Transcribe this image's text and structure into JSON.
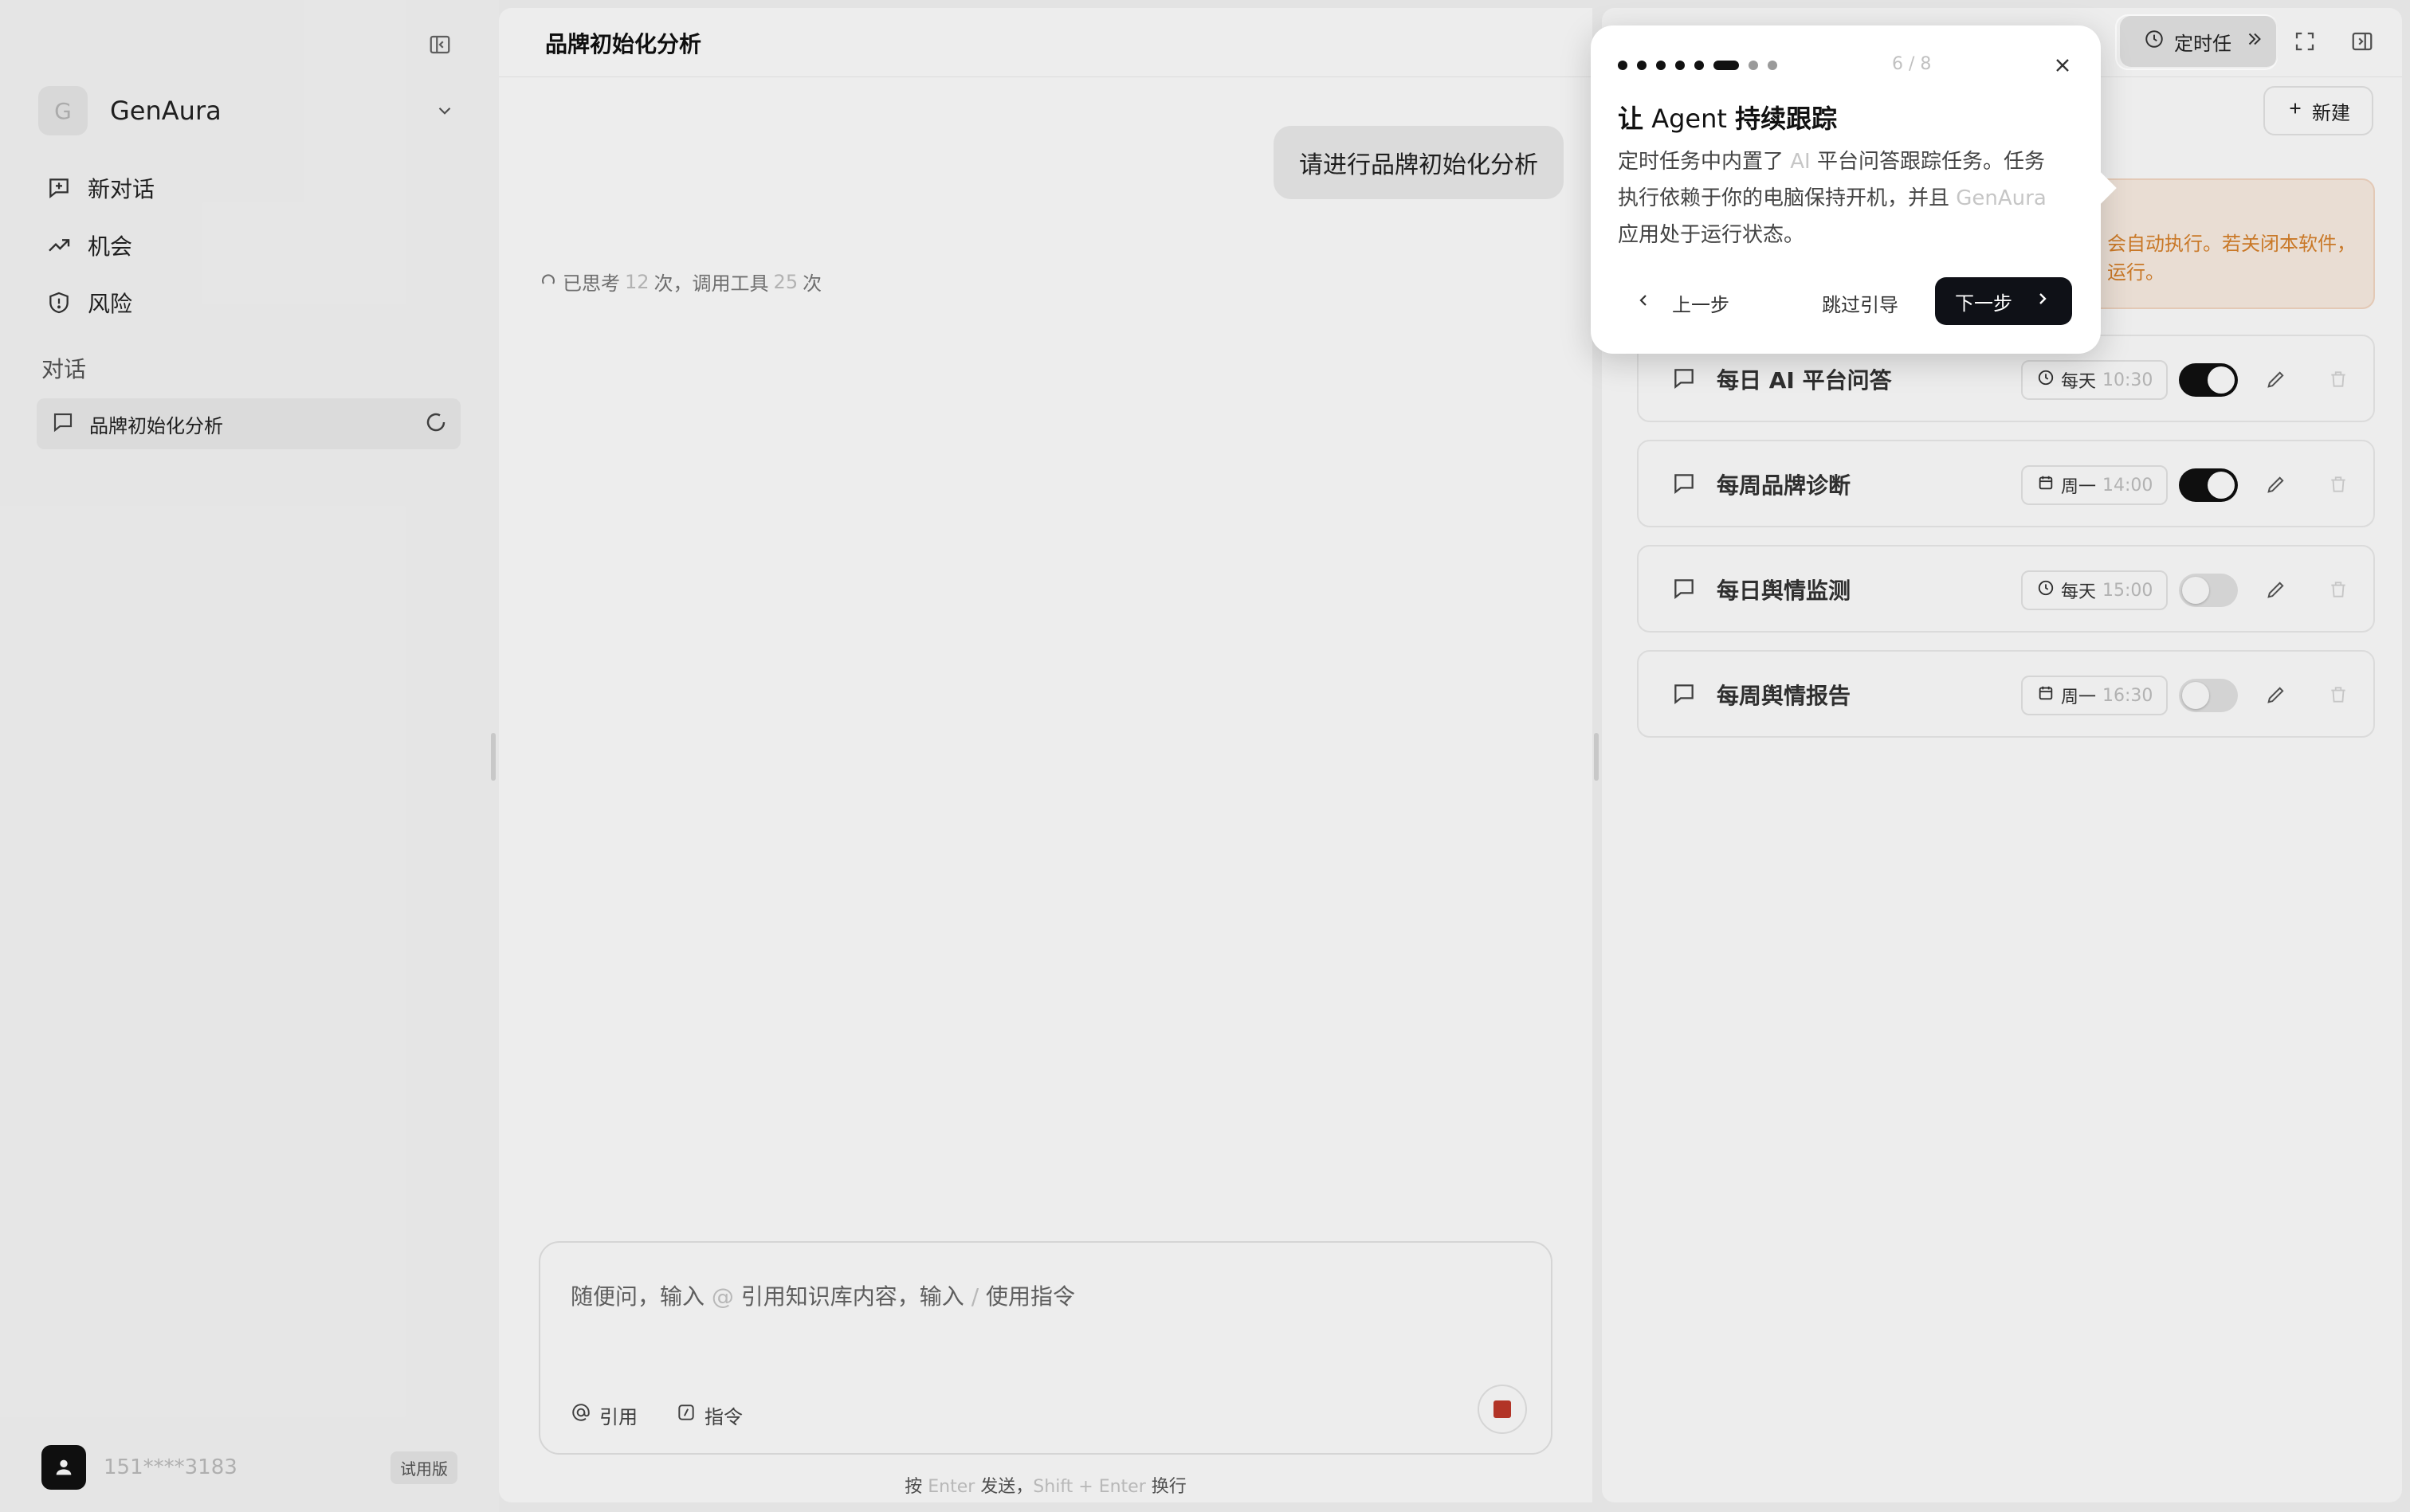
{
  "sidebar": {
    "workspace": {
      "initial": "G",
      "name": "GenAura"
    },
    "nav": [
      {
        "label": "新对话",
        "icon": "new-chat-icon"
      },
      {
        "label": "机会",
        "icon": "trending-up-icon"
      },
      {
        "label": "风险",
        "icon": "shield-alert-icon"
      }
    ],
    "section_label": "对话",
    "conversations": [
      {
        "label": "品牌初始化分析",
        "status": "loading"
      }
    ],
    "user": {
      "phone": "151****3183",
      "plan": "试用版"
    }
  },
  "main": {
    "title": "品牌初始化分析",
    "user_message": "请进行品牌初始化分析",
    "thinking": {
      "prefix": "已思考",
      "think_count": "12",
      "middle": "次，调用工具",
      "tool_count": "25",
      "suffix": "次"
    },
    "input": {
      "placeholder_parts": [
        "随便问，输入 ",
        "@",
        " 引用知识库内容，输入 ",
        "/",
        " 使用指令"
      ],
      "cite_label": "引用",
      "command_label": "指令"
    },
    "hint_parts": [
      "按 ",
      "Enter",
      " 发送，",
      "Shift + Enter",
      " 换行"
    ]
  },
  "right_panel": {
    "tab_label": "定时任",
    "new_button": "新建",
    "notice_lines": [
      "会自动执行。若关闭本软件，",
      "运行。"
    ],
    "tasks": [
      {
        "name": "每日 AI 平台问答",
        "freq": "每天",
        "time": "10:30",
        "enabled": true,
        "sched_icon": "clock-icon"
      },
      {
        "name": "每周品牌诊断",
        "freq": "周一",
        "time": "14:00",
        "enabled": true,
        "sched_icon": "calendar-icon"
      },
      {
        "name": "每日舆情监测",
        "freq": "每天",
        "time": "15:00",
        "enabled": false,
        "sched_icon": "clock-icon"
      },
      {
        "name": "每周舆情报告",
        "freq": "周一",
        "time": "16:30",
        "enabled": false,
        "sched_icon": "calendar-icon"
      }
    ]
  },
  "tour": {
    "step": 6,
    "total": 8,
    "step_label": "6 / 8",
    "title_prefix": "让",
    "title_mid": " Agent ",
    "title_bold": "持续跟踪",
    "body_parts": [
      {
        "text": "定时任务中内置了 ",
        "muted": false
      },
      {
        "text": "AI",
        "muted": true
      },
      {
        "text": " 平台问答跟踪任务。任务执行依赖于你的电脑保持开机，并且 ",
        "muted": false
      },
      {
        "text": "GenAura",
        "muted": true
      },
      {
        "text": " 应用处于运行状态。",
        "muted": false
      }
    ],
    "prev_label": "上一步",
    "skip_label": "跳过引导",
    "next_label": "下一步"
  },
  "colors": {
    "accent": "#0f1117",
    "stop": "#c0392b",
    "notice": "#d9822b"
  }
}
